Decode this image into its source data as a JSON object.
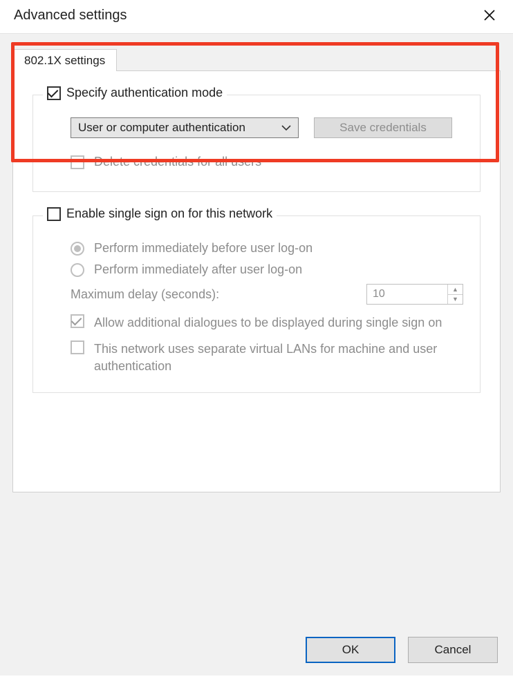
{
  "title": "Advanced settings",
  "tab_label": "802.1X settings",
  "auth_group": {
    "legend": "Specify authentication mode",
    "mode_selected": "User or computer authentication",
    "save_btn": "Save credentials",
    "delete_label": "Delete credentials for all users"
  },
  "sso_group": {
    "legend": "Enable single sign on for this network",
    "radio_before": "Perform immediately before user log-on",
    "radio_after": "Perform immediately after user log-on",
    "delay_label": "Maximum delay (seconds):",
    "delay_value": "10",
    "allow_dialogs": "Allow additional dialogues to be displayed during single sign on",
    "separate_vlan": "This network uses separate virtual LANs for machine and user authentication"
  },
  "buttons": {
    "ok": "OK",
    "cancel": "Cancel"
  }
}
